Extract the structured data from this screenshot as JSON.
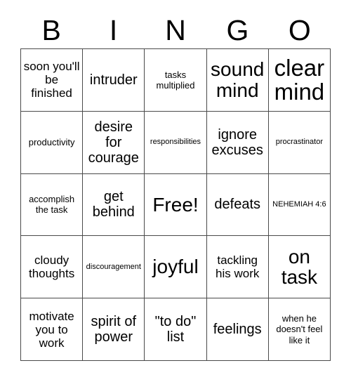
{
  "card": {
    "title": "BINGO",
    "header_letters": [
      "B",
      "I",
      "N",
      "G",
      "O"
    ],
    "grid_size": "5x5",
    "free_space": "Free!",
    "border_color": "#4a4a4a",
    "text_color": "#000000",
    "background_color": "#ffffff",
    "rows": [
      [
        {
          "text": "soon you'll be finished",
          "size": "sm"
        },
        {
          "text": "intruder",
          "size": "md"
        },
        {
          "text": "tasks multiplied",
          "size": "xs"
        },
        {
          "text": "sound mind",
          "size": "xl"
        },
        {
          "text": "clear mind",
          "size": "xxl"
        }
      ],
      [
        {
          "text": "productivity",
          "size": "xs"
        },
        {
          "text": "desire for courage",
          "size": "md"
        },
        {
          "text": "responsibilities",
          "size": "xxs"
        },
        {
          "text": "ignore excuses",
          "size": "md"
        },
        {
          "text": "procrastinator",
          "size": "xxs"
        }
      ],
      [
        {
          "text": "accomplish the task",
          "size": "xs"
        },
        {
          "text": "get behind",
          "size": "md"
        },
        {
          "text": "Free!",
          "size": "xl"
        },
        {
          "text": "defeats",
          "size": "md"
        },
        {
          "text": "NEHEMIAH 4:6",
          "size": "xxs"
        }
      ],
      [
        {
          "text": "cloudy thoughts",
          "size": "sm"
        },
        {
          "text": "discouragement",
          "size": "xxs"
        },
        {
          "text": "joyful",
          "size": "xl"
        },
        {
          "text": "tackling his work",
          "size": "sm"
        },
        {
          "text": "on task",
          "size": "xl"
        }
      ],
      [
        {
          "text": "motivate you to work",
          "size": "sm"
        },
        {
          "text": "spirit of power",
          "size": "md"
        },
        {
          "text": "\"to do\" list",
          "size": "md"
        },
        {
          "text": "feelings",
          "size": "md"
        },
        {
          "text": "when he doesn't feel like it",
          "size": "xs"
        }
      ]
    ]
  }
}
